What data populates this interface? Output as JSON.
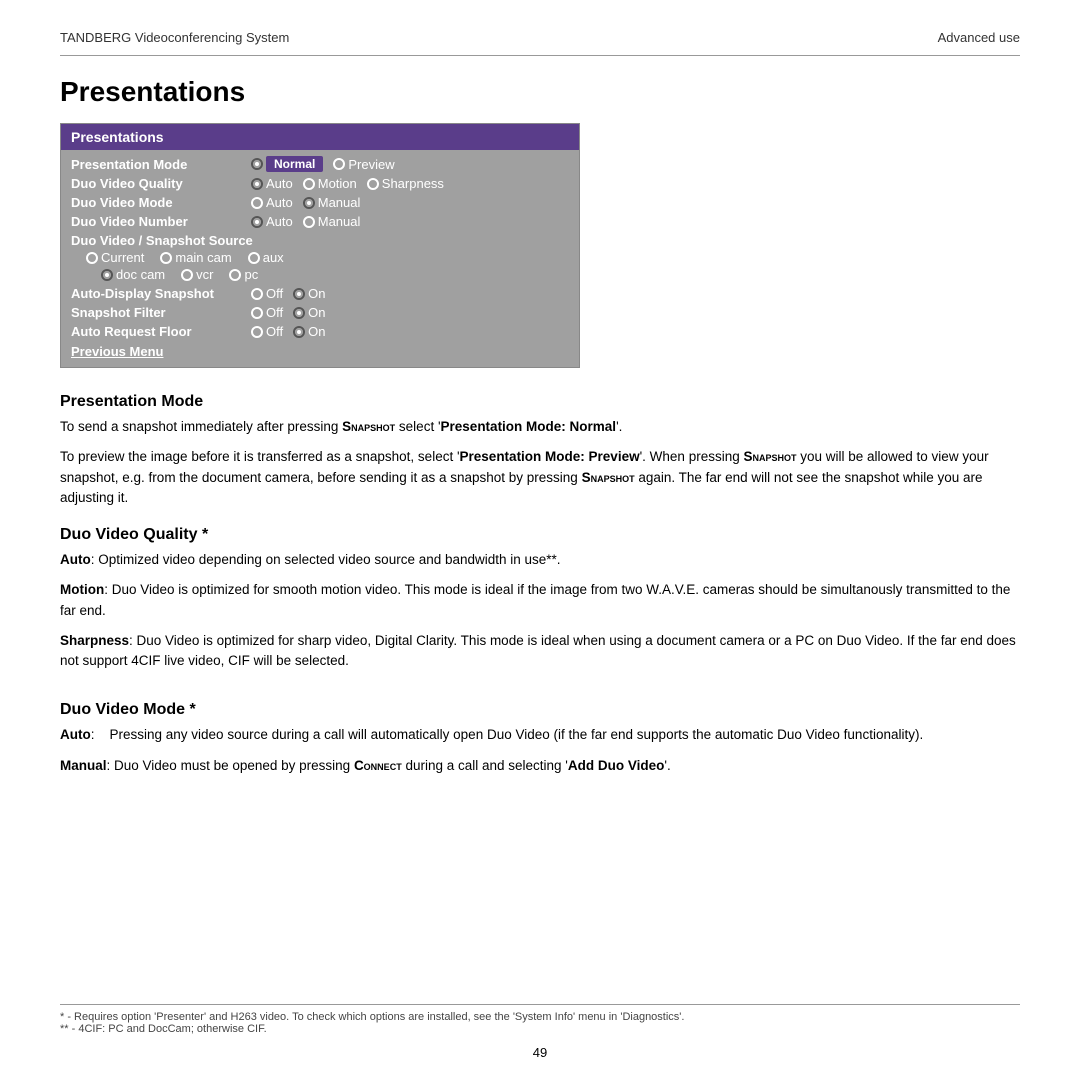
{
  "header": {
    "title": "TANDBERG Videoconferencing System",
    "section": "Advanced use"
  },
  "page_title": "Presentations",
  "menu": {
    "header_label": "Presentations",
    "rows": [
      {
        "label": "Presentation Mode",
        "options": [
          {
            "text": "Normal",
            "selected": true,
            "badge": true
          },
          {
            "text": "Preview",
            "selected": false
          }
        ]
      },
      {
        "label": "Duo Video Quality",
        "options": [
          {
            "text": "Auto",
            "selected": true
          },
          {
            "text": "Motion",
            "selected": false
          },
          {
            "text": "Sharpness",
            "selected": false
          }
        ]
      },
      {
        "label": "Duo Video Mode",
        "options": [
          {
            "text": "Auto",
            "selected": false
          },
          {
            "text": "Manual",
            "selected": true
          }
        ]
      },
      {
        "label": "Duo Video Number",
        "options": [
          {
            "text": "Auto",
            "selected": true
          },
          {
            "text": "Manual",
            "selected": false
          }
        ]
      }
    ],
    "snapshot_source": {
      "label": "Duo Video / Snapshot Source",
      "options_row1": [
        {
          "text": "Current",
          "selected": false
        },
        {
          "text": "main cam",
          "selected": false
        },
        {
          "text": "aux",
          "selected": false
        }
      ],
      "options_row2": [
        {
          "text": "doc cam",
          "selected": true
        },
        {
          "text": "vcr",
          "selected": false
        },
        {
          "text": "pc",
          "selected": false
        }
      ]
    },
    "toggle_rows": [
      {
        "label": "Auto-Display Snapshot",
        "off_selected": false,
        "on_selected": true
      },
      {
        "label": "Snapshot Filter",
        "off_selected": false,
        "on_selected": true
      },
      {
        "label": "Auto Request Floor",
        "off_selected": false,
        "on_selected": true
      }
    ],
    "previous_menu": "Previous Menu"
  },
  "sections": [
    {
      "id": "presentation_mode",
      "title": "Presentation Mode",
      "paragraphs": [
        "To send a snapshot immediately after pressing SNAPSHOT select 'Presentation Mode: Normal'.",
        "To preview the image before it is transferred as a snapshot, select 'Presentation Mode: Preview'. When pressing SNAPSHOT you will be allowed to view your snapshot, e.g. from the document camera, before sending it as a snapshot by pressing SNAPSHOT again. The far end will not see the snapshot while you are adjusting it."
      ]
    },
    {
      "id": "duo_video_quality",
      "title": "Duo Video Quality *",
      "paragraphs": [
        "Auto: Optimized video depending on selected video source and bandwidth in use**.",
        "Motion: Duo Video is optimized for smooth motion video. This mode is ideal if the image from two W.A.V.E. cameras should be simultanously transmitted to the far end.",
        "Sharpness: Duo Video is optimized for sharp video, Digital Clarity. This mode is ideal when using a document camera or a PC on Duo Video. If the far end does not support 4CIF live video, CIF will be selected."
      ]
    },
    {
      "id": "duo_video_mode",
      "title": "Duo Video Mode *",
      "paragraphs": [
        "Auto:    Pressing any video source during a call will automatically open Duo Video (if the far end supports the automatic Duo Video functionality).",
        "Manual: Duo Video must be opened by pressing CONNECT during a call and selecting 'Add Duo Video'."
      ]
    }
  ],
  "footnotes": [
    "* - Requires option 'Presenter' and H263 video. To check which options are installed, see the 'System Info' menu in 'Diagnostics'.",
    "** - 4CIF: PC and DocCam; otherwise CIF."
  ],
  "page_number": "49"
}
